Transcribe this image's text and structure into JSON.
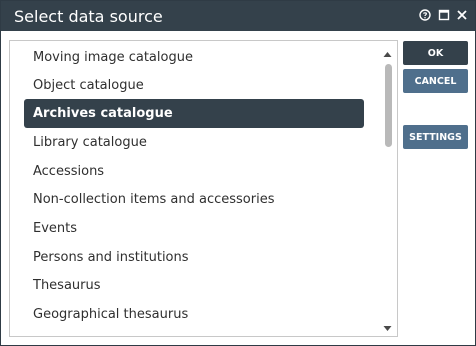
{
  "dialog": {
    "title": "Select data source",
    "buttons": {
      "ok": "OK",
      "cancel": "CANCEL",
      "settings": "SETTINGS"
    },
    "title_icons": [
      "help-icon",
      "maximize-icon",
      "close-icon"
    ]
  },
  "list": {
    "selected_index": 2,
    "items": [
      {
        "label": "Moving image catalogue"
      },
      {
        "label": "Object catalogue"
      },
      {
        "label": "Archives catalogue"
      },
      {
        "label": "Library catalogue"
      },
      {
        "label": "Accessions"
      },
      {
        "label": "Non-collection items and accessories"
      },
      {
        "label": "Events"
      },
      {
        "label": "Persons and institutions"
      },
      {
        "label": "Thesaurus"
      },
      {
        "label": "Geographical thesaurus"
      }
    ]
  },
  "colors": {
    "titlebar": "#34414b",
    "selected_row": "#34414b",
    "button": "#4f6f8c",
    "primary_button": "#34414b"
  }
}
